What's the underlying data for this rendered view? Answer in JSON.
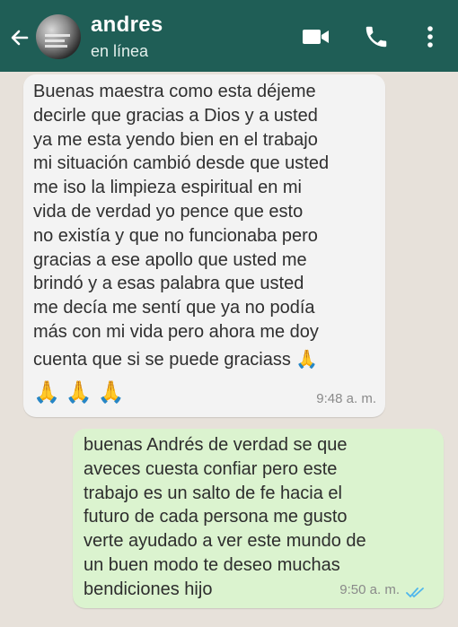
{
  "header": {
    "contact_name": "andres",
    "status": "en línea",
    "icons": [
      "back-arrow-icon",
      "video-call-icon",
      "phone-icon",
      "more-options-icon"
    ],
    "background_color": "#1f5e56"
  },
  "messages": [
    {
      "direction": "incoming",
      "lines": [
        "Buenas maestra como esta déjeme",
        "decirle que gracias a Dios y a usted",
        "ya me esta yendo bien en el trabajo",
        "mi situación cambió desde que usted",
        "me iso la limpieza espiritual en mi",
        "vida de verdad yo pence que esto",
        "no existía y que no funcionaba pero",
        "gracias a ese apollo que usted me",
        "brindó y a esas palabra que usted",
        "me decía me sentí que ya no podía",
        "más con mi vida pero ahora me doy",
        "cuenta que si se puede graciass 🙏",
        "🙏🙏🙏"
      ],
      "time": "9:48 a. m.",
      "bubble_color": "#f3f3f3"
    },
    {
      "direction": "outgoing",
      "lines": [
        "buenas Andrés de verdad se que",
        "aveces cuesta confiar pero este",
        "trabajo es un salto de fe hacia el",
        "futuro de cada persona me gusto",
        "verte ayudado a ver este mundo de",
        "un buen modo te deseo muchas",
        "bendiciones hijo"
      ],
      "time": "9:50 a. m.",
      "read_receipt": "double-check-icon",
      "bubble_color": "#dbf3cf",
      "receipt_color": "#4fb6ec"
    }
  ]
}
